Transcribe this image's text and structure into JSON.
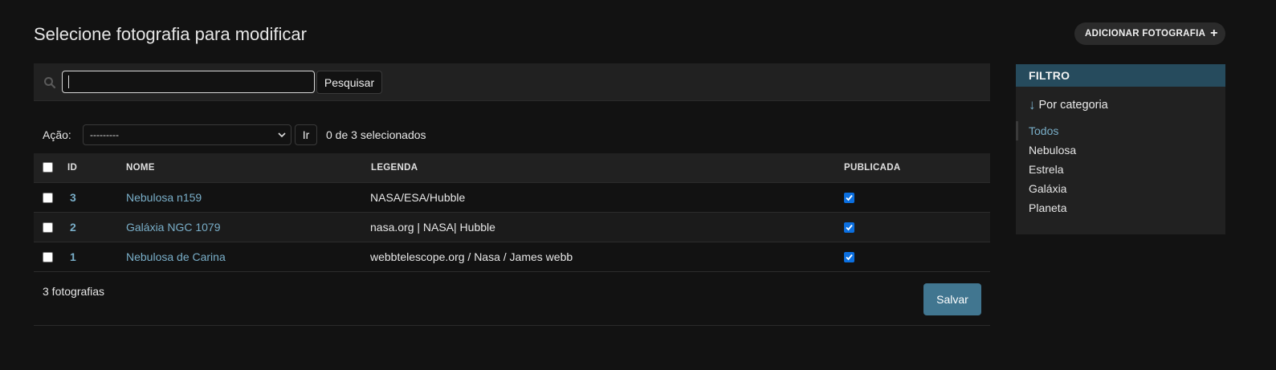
{
  "header": {
    "title": "Selecione fotografia para modificar",
    "add_button": "ADICIONAR FOTOGRAFIA",
    "add_icon": "plus-icon"
  },
  "search": {
    "value": "",
    "placeholder": "",
    "button": "Pesquisar",
    "icon": "search-icon"
  },
  "actions": {
    "label": "Ação:",
    "selected_option": "---------",
    "go_button": "Ir",
    "counter": "0 de 3 selecionados"
  },
  "table": {
    "columns": [
      "ID",
      "NOME",
      "LEGENDA",
      "PUBLICADA"
    ],
    "rows": [
      {
        "id": "3",
        "nome": "Nebulosa n159",
        "legenda": "NASA/ESA/Hubble",
        "publicada": true
      },
      {
        "id": "2",
        "nome": "Galáxia NGC 1079",
        "legenda": "nasa.org | NASA| Hubble",
        "publicada": true
      },
      {
        "id": "1",
        "nome": "Nebulosa de Carina",
        "legenda": "webbtelescope.org / Nasa / James webb",
        "publicada": true
      }
    ]
  },
  "footer": {
    "count": "3 fotografias",
    "save_button": "Salvar"
  },
  "filter": {
    "header": "FILTRO",
    "title": "Por categoria",
    "title_icon": "arrow-down-icon",
    "options": [
      "Todos",
      "Nebulosa",
      "Estrela",
      "Galáxia",
      "Planeta"
    ],
    "selected": "Todos"
  },
  "colors": {
    "background": "#121212",
    "link": "#79aec8",
    "filter_header": "#264b5d",
    "save_button": "#417690",
    "checkbox_checked": "#0b6fe0"
  }
}
